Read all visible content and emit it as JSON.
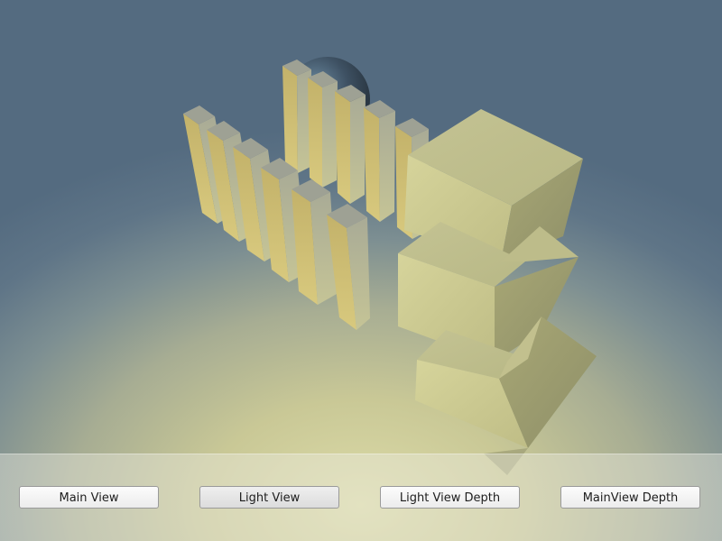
{
  "buttons": {
    "main_view": "Main View",
    "light_view": "Light View",
    "light_view_depth": "Light View Depth",
    "main_view_depth": "MainView Depth"
  },
  "colors": {
    "sky_top": "#546b80",
    "ground_glow": "#dcdba8",
    "object_light": "#d0cc94",
    "object_mid": "#a9a877",
    "object_dark": "#8b8c70",
    "sphere": "#3d4b58"
  }
}
